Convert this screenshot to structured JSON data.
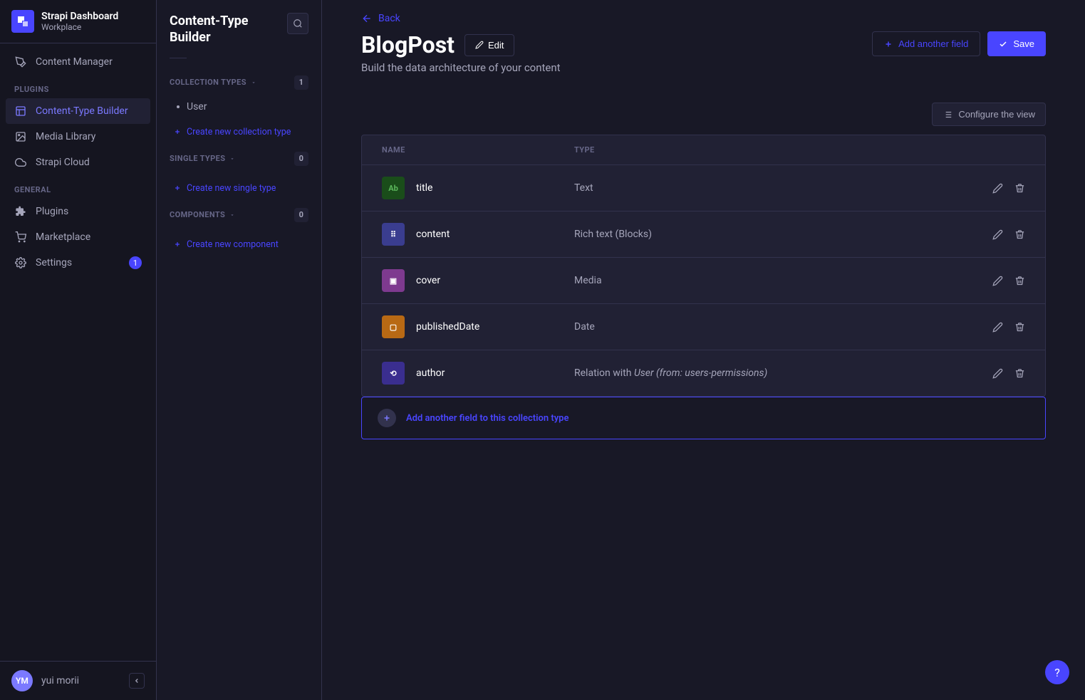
{
  "brand": {
    "title": "Strapi Dashboard",
    "subtitle": "Workplace"
  },
  "nav": {
    "items": [
      {
        "label": "Content Manager"
      }
    ],
    "plugins_label": "PLUGINS",
    "plugin_items": [
      {
        "label": "Content-Type Builder",
        "active": true
      },
      {
        "label": "Media Library"
      },
      {
        "label": "Strapi Cloud"
      }
    ],
    "general_label": "GENERAL",
    "general_items": [
      {
        "label": "Plugins"
      },
      {
        "label": "Marketplace"
      },
      {
        "label": "Settings",
        "badge": "1"
      }
    ]
  },
  "user": {
    "initials": "YM",
    "name": "yui morii"
  },
  "sub": {
    "title": "Content-Type Builder",
    "groups": [
      {
        "label": "COLLECTION TYPES",
        "count": "1",
        "items": [
          {
            "label": "User"
          }
        ],
        "create": "Create new collection type"
      },
      {
        "label": "SINGLE TYPES",
        "count": "0",
        "items": [],
        "create": "Create new single type"
      },
      {
        "label": "COMPONENTS",
        "count": "0",
        "items": [],
        "create": "Create new component"
      }
    ]
  },
  "main": {
    "back": "Back",
    "title": "BlogPost",
    "edit": "Edit",
    "desc": "Build the data architecture of your content",
    "add_field": "Add another field",
    "save": "Save",
    "configure": "Configure the view",
    "columns": {
      "name": "NAME",
      "type": "TYPE"
    },
    "fields": [
      {
        "icon_class": "fi-text",
        "icon_label": "Ab",
        "name": "title",
        "type": "Text"
      },
      {
        "icon_class": "fi-rich",
        "icon_label": "⠿",
        "name": "content",
        "type": "Rich text (Blocks)"
      },
      {
        "icon_class": "fi-media",
        "icon_label": "▣",
        "name": "cover",
        "type": "Media"
      },
      {
        "icon_class": "fi-date",
        "icon_label": "▢",
        "name": "publishedDate",
        "type": "Date"
      },
      {
        "icon_class": "fi-rel",
        "icon_label": "⟲",
        "name": "author",
        "type_prefix": "Relation with ",
        "type_em": "User (from: users-permissions)"
      }
    ],
    "add_field_bottom": "Add another field to this collection type"
  }
}
